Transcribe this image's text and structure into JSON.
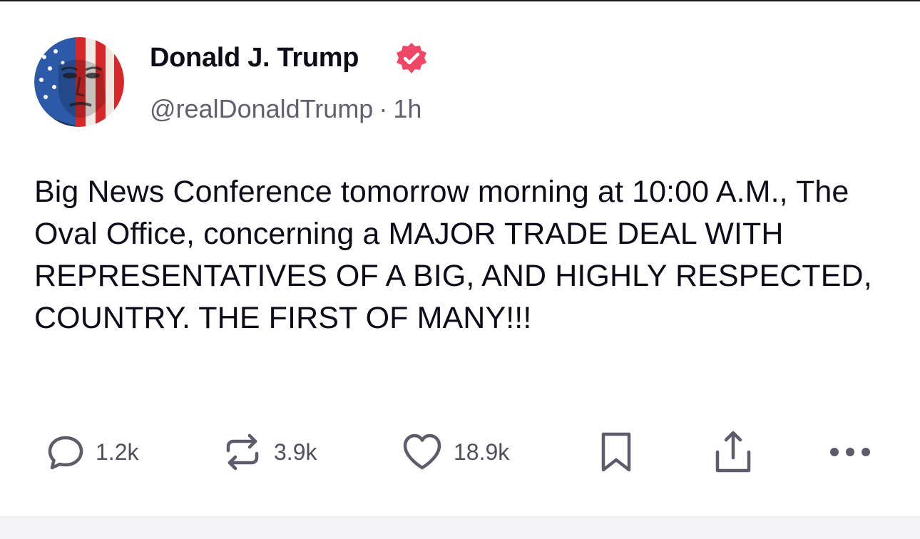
{
  "post": {
    "display_name": "Donald J. Trump",
    "handle": "@realDonaldTrump",
    "separator": "·",
    "time_ago": "1h",
    "text": "Big News Conference tomorrow morning at 10:00 A.M., The Oval Office, concerning a MAJOR TRADE DEAL WITH REPRESENTATIVES OF A BIG, AND HIGHLY RESPECTED, COUNTRY. THE FIRST OF MANY!!!"
  },
  "actions": {
    "replies": "1.2k",
    "retruths": "3.9k",
    "likes": "18.9k"
  },
  "icons": {
    "reply": "speech-bubble-icon",
    "retruth": "repost-arrows-icon",
    "like": "heart-icon",
    "bookmark": "bookmark-icon",
    "share": "share-upload-icon",
    "more": "ellipsis-icon",
    "verified": "verified-badge-icon"
  },
  "colors": {
    "verified_badge": "#ef4765",
    "action_icon": "#5c5c6a",
    "text": "#0d0d1a",
    "meta": "#60606e"
  }
}
